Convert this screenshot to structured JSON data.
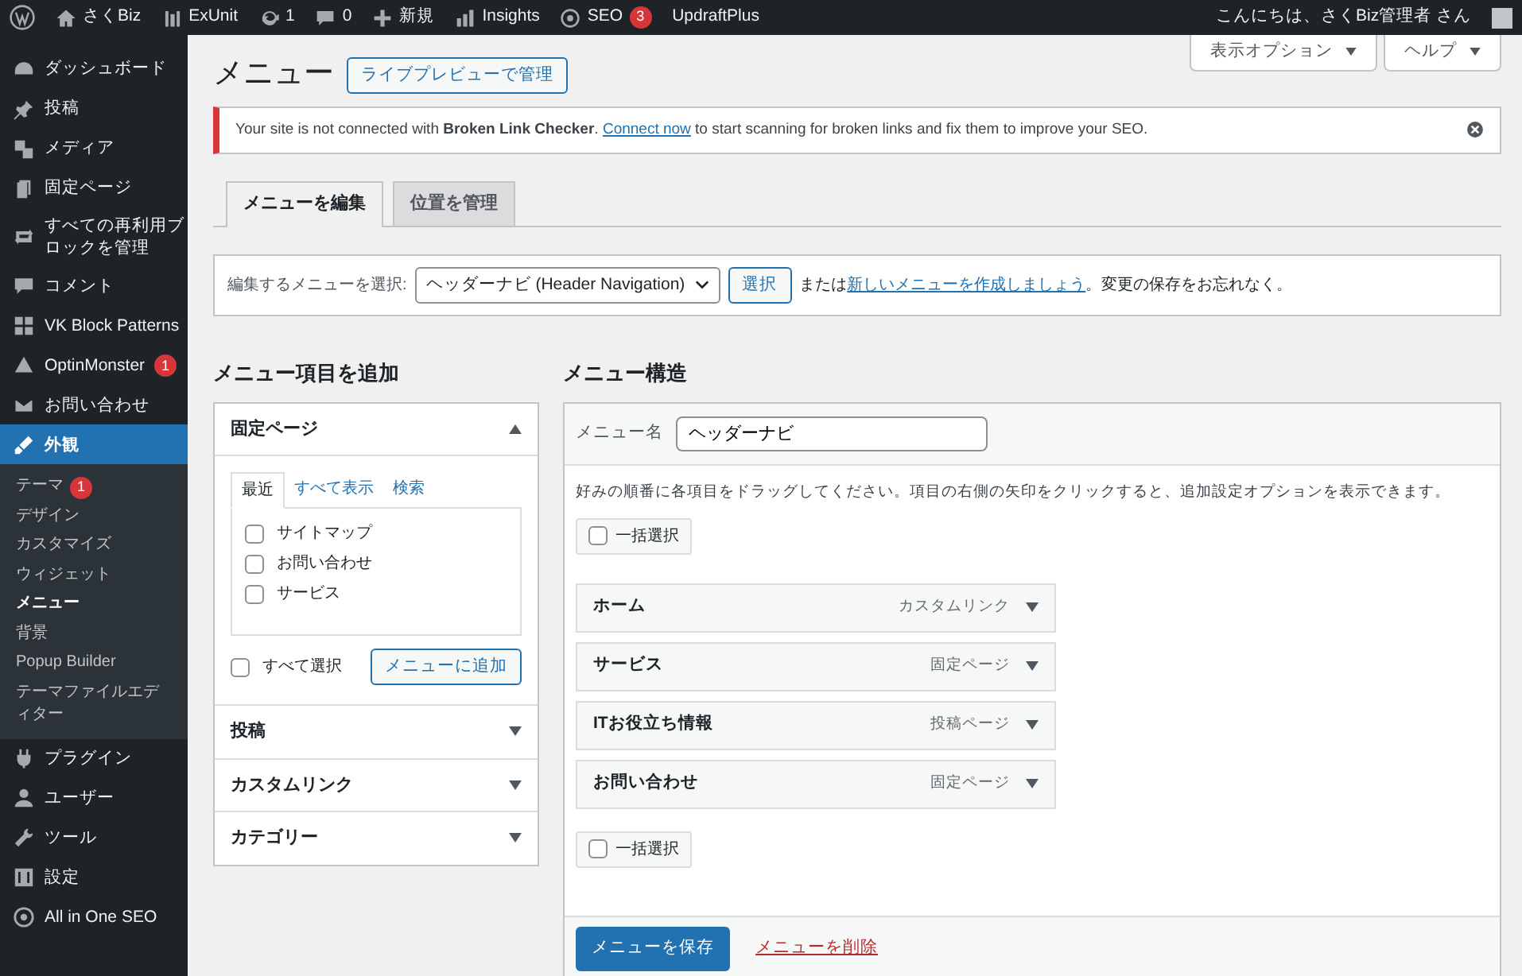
{
  "admin_bar": {
    "items": [
      {
        "label": "さくBiz"
      },
      {
        "label": "ExUnit"
      },
      {
        "label": "1"
      },
      {
        "label": "0"
      },
      {
        "label": "新規"
      },
      {
        "label": "Insights"
      },
      {
        "label": "SEO",
        "badge": "3"
      },
      {
        "label": "UpdraftPlus"
      }
    ],
    "greeting": "こんにちは、さくBiz管理者 さん"
  },
  "sidebar": {
    "items": [
      {
        "label": "ダッシュボード",
        "selected": false
      },
      {
        "label": "投稿",
        "selected": false
      },
      {
        "label": "メディア",
        "selected": false
      },
      {
        "label": "固定ページ",
        "selected": false
      },
      {
        "label": "すべての再利用ブロックを管理",
        "selected": false
      },
      {
        "label": "コメント",
        "selected": false
      },
      {
        "label": "VK Block Patterns",
        "selected": false
      },
      {
        "label": "OptinMonster",
        "badge": "1",
        "selected": false
      },
      {
        "label": "お問い合わせ",
        "selected": false
      },
      {
        "label": "外観",
        "selected": true,
        "children": [
          {
            "label": "テーマ",
            "badge": "1",
            "selected": false
          },
          {
            "label": "デザイン",
            "selected": false
          },
          {
            "label": "カスタマイズ",
            "selected": false
          },
          {
            "label": "ウィジェット",
            "selected": false
          },
          {
            "label": "メニュー",
            "selected": true
          },
          {
            "label": "背景",
            "selected": false
          },
          {
            "label": "Popup Builder",
            "selected": false
          },
          {
            "label": "テーマファイルエディター",
            "selected": false
          }
        ]
      },
      {
        "label": "プラグイン",
        "selected": false
      },
      {
        "label": "ユーザー",
        "selected": false
      },
      {
        "label": "ツール",
        "selected": false
      },
      {
        "label": "設定",
        "selected": false
      },
      {
        "label": "All in One SEO",
        "selected": false
      }
    ]
  },
  "screen_buttons": [
    "表示オプション",
    "ヘルプ"
  ],
  "page_title": "メニュー",
  "live_preview_button": "ライブプレビューで管理",
  "notice": {
    "text": "Your site is not connected with **Broken Link Checker**.",
    "link": "Connect now",
    "after": "to start scanning for broken links and fix them to improve your SEO."
  },
  "tabs": [
    {
      "label": "メニューを編集",
      "selected": true
    },
    {
      "label": "位置を管理",
      "selected": false
    }
  ],
  "select_bar": {
    "label": "編集するメニューを選択:",
    "value": "ヘッダーナビ (Header Navigation)",
    "button": "選択",
    "text_before": "または",
    "link": "新しいメニューを作成しましょう",
    "text_after": "。変更の保存をお忘れなく。"
  },
  "add_items": {
    "heading": "メニュー項目を追加",
    "sections": [
      {
        "title": "固定ページ",
        "expanded": true,
        "tabs": [
          {
            "label": "最近",
            "selected": true
          },
          {
            "label": "すべて表示",
            "selected": false
          },
          {
            "label": "検索",
            "selected": false
          }
        ],
        "pages": [
          {
            "label": "サイトマップ",
            "checked": false
          },
          {
            "label": "お問い合わせ",
            "checked": false
          },
          {
            "label": "サービス",
            "checked": false
          }
        ],
        "select_all": {
          "label": "すべて選択",
          "checked": false
        },
        "add_button": "メニューに追加"
      },
      {
        "title": "投稿",
        "expanded": false
      },
      {
        "title": "カスタムリンク",
        "expanded": false
      },
      {
        "title": "カテゴリー",
        "expanded": false
      }
    ]
  },
  "structure": {
    "heading": "メニュー構造",
    "name_label": "メニュー名",
    "name_value": "ヘッダーナビ",
    "instructions": "好みの順番に各項目をドラッグしてください。項目の右側の矢印をクリックすると、追加設定オプションを表示できます。",
    "bulk_top": {
      "label": "一括選択",
      "checked": false
    },
    "items": [
      {
        "title": "ホーム",
        "type": "カスタムリンク"
      },
      {
        "title": "サービス",
        "type": "固定ページ"
      },
      {
        "title": "ITお役立ち情報",
        "type": "投稿ページ"
      },
      {
        "title": "お問い合わせ",
        "type": "固定ページ"
      }
    ],
    "bulk_bottom": {
      "label": "一括選択",
      "checked": false
    },
    "save_button": "メニューを保存",
    "delete_link": "メニューを削除"
  }
}
